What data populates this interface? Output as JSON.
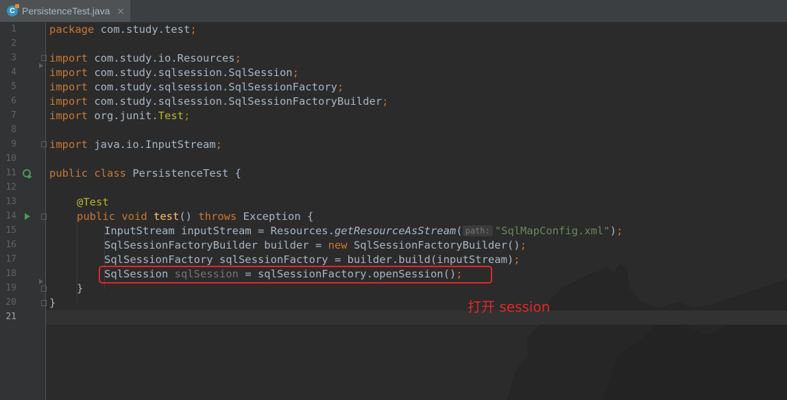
{
  "tab": {
    "label": "PersistenceTest.java",
    "icon_letter": "C",
    "close_glyph": "⨯",
    "icon": "java-class-icon"
  },
  "gutter": {
    "line_numbers": [
      "1",
      "2",
      "3",
      "4",
      "5",
      "6",
      "7",
      "8",
      "9",
      "10",
      "11",
      "12",
      "13",
      "14",
      "15",
      "16",
      "17",
      "18",
      "19",
      "20",
      "21"
    ]
  },
  "code": {
    "l1": {
      "kw": "package",
      "rest": " com.study.test",
      "semi": ";"
    },
    "l3": {
      "kw": "import",
      "rest": " com.study.io.Resources",
      "semi": ";"
    },
    "l4": {
      "kw": "import",
      "rest": " com.study.sqlsession.SqlSession",
      "semi": ";"
    },
    "l5": {
      "kw": "import",
      "rest": " com.study.sqlsession.SqlSessionFactory",
      "semi": ";"
    },
    "l6": {
      "kw": "import",
      "rest": " com.study.sqlsession.SqlSessionFactoryBuilder",
      "semi": ";"
    },
    "l7": {
      "kw": "import",
      "rest": " org.junit.",
      "cls": "Test",
      "semi": ";"
    },
    "l9": {
      "kw": "import",
      "rest": " java.io.InputStream",
      "semi": ";"
    },
    "l11": {
      "kw1": "public",
      "kw2": "class",
      "rest": " PersistenceTest {"
    },
    "l13": {
      "annotation": "@Test"
    },
    "l14": {
      "kw1": "public",
      "kw2": "void",
      "fn": "test",
      "rest1": "() ",
      "kw3": "throws",
      "rest2": " Exception {"
    },
    "l15": {
      "a": "InputStream inputStream = Resources.",
      "method": "getResourceAsStream",
      "b": "(",
      "hint": "path:",
      "str": "\"SqlMapConfig.xml\"",
      "c": ")",
      "semi": ";"
    },
    "l16": {
      "a": "SqlSessionFactoryBuilder builder = ",
      "kw": "new",
      "b": " SqlSessionFactoryBuilder()",
      "semi": ";"
    },
    "l17": {
      "a": "SqlSessionFactory sqlSessionFactory = builder.build(inputStream)",
      "semi": ";"
    },
    "l18": {
      "a": "SqlSession ",
      "unused": "sqlSession",
      "b": " = sqlSessionFactory.openSession()",
      "semi": ";"
    },
    "l19": {
      "a": "}"
    },
    "l20": {
      "a": "}"
    }
  },
  "annotation_note": "打开 session",
  "colors": {
    "keyword": "#cc7832",
    "string": "#6a8759",
    "annotation": "#bbb529",
    "method": "#ffc66d",
    "highlight": "#e2282b"
  }
}
